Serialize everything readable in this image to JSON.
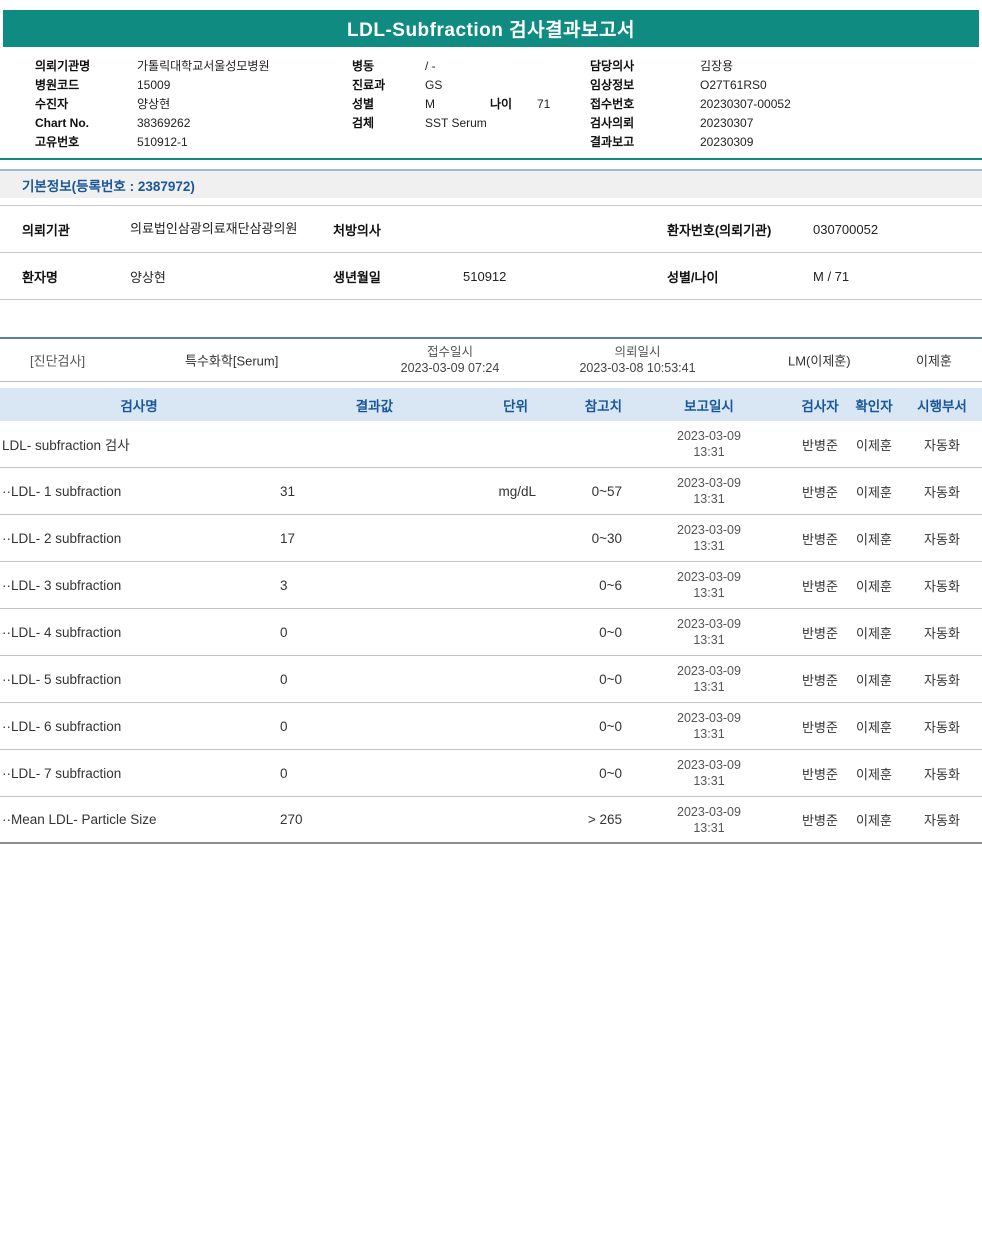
{
  "title": "LDL-Subfraction 검사결과보고서",
  "colors": {
    "teal": "#0F8B81",
    "header_blue": "#1A5799",
    "table_header_bg": "#D9E7F5",
    "section_bar_bg": "#F0F0F0",
    "rule_blue": "#5B7FA8",
    "rule_light_blue": "#9DB8DC"
  },
  "patient_header": {
    "left": [
      {
        "label": "의뢰기관명",
        "value": "가톨릭대학교서울성모병원"
      },
      {
        "label": "병원코드",
        "value": "15009"
      },
      {
        "label": "수진자",
        "value": "양상현"
      },
      {
        "label": "Chart No.",
        "value": "38369262"
      },
      {
        "label": "고유번호",
        "value": "510912-1"
      }
    ],
    "middle": {
      "ward_label": "병동",
      "ward_value": "/ -",
      "dept_label": "진료과",
      "dept_value": "GS",
      "sex_label": "성별",
      "sex_value": "M",
      "age_label": "나이",
      "age_value": "71",
      "specimen_label": "검체",
      "specimen_value": "SST Serum"
    },
    "right": [
      {
        "label": "담당의사",
        "value": "김장용"
      },
      {
        "label": "임상정보",
        "value": "O27T61RS0"
      },
      {
        "label": "접수번호",
        "value": "20230307-00052"
      },
      {
        "label": "검사의뢰",
        "value": "20230307"
      },
      {
        "label": "결과보고",
        "value": "20230309"
      }
    ]
  },
  "basic_info": {
    "section_title": "기본정보(등록번호 : 2387972)",
    "row1": {
      "l1": "의뢰기관",
      "v1": "의료법인삼광의료재단삼광의원",
      "l2": "처방의사",
      "v2": "",
      "l3": "환자번호(의뢰기관)",
      "v3": "030700052"
    },
    "row2": {
      "l1": "환자명",
      "v1": "양상현",
      "l2": "생년월일",
      "v2": "510912",
      "l3": "성별/나이",
      "v3": "M / 71"
    }
  },
  "test_meta": {
    "category": "[진단검사]",
    "panel": "특수화학[Serum]",
    "receive_label": "접수일시",
    "receive_value": "2023-03-09 07:24",
    "order_label": "의뢰일시",
    "order_value": "2023-03-08 10:53:41",
    "lab_code": "LM(이제훈)",
    "reader": "이제훈"
  },
  "results": {
    "headers": {
      "name": "검사명",
      "result": "결과값",
      "unit": "단위",
      "ref": "참고치",
      "report": "보고일시",
      "tester": "검사자",
      "confirmer": "확인자",
      "dept": "시행부서"
    },
    "rows": [
      {
        "name": "LDL- subfraction 검사",
        "result": "",
        "unit": "",
        "ref": "",
        "date": "2023-03-09",
        "time": "13:31",
        "tester": "반병준",
        "confirmer": "이제훈",
        "dept": "자동화"
      },
      {
        "name": "··LDL- 1 subfraction",
        "result": "31",
        "unit": "mg/dL",
        "ref": "0~57",
        "date": "2023-03-09",
        "time": "13:31",
        "tester": "반병준",
        "confirmer": "이제훈",
        "dept": "자동화"
      },
      {
        "name": "··LDL- 2 subfraction",
        "result": "17",
        "unit": "",
        "ref": "0~30",
        "date": "2023-03-09",
        "time": "13:31",
        "tester": "반병준",
        "confirmer": "이제훈",
        "dept": "자동화"
      },
      {
        "name": "··LDL- 3 subfraction",
        "result": "3",
        "unit": "",
        "ref": "0~6",
        "date": "2023-03-09",
        "time": "13:31",
        "tester": "반병준",
        "confirmer": "이제훈",
        "dept": "자동화"
      },
      {
        "name": "··LDL- 4 subfraction",
        "result": "0",
        "unit": "",
        "ref": "0~0",
        "date": "2023-03-09",
        "time": "13:31",
        "tester": "반병준",
        "confirmer": "이제훈",
        "dept": "자동화"
      },
      {
        "name": "··LDL- 5 subfraction",
        "result": "0",
        "unit": "",
        "ref": "0~0",
        "date": "2023-03-09",
        "time": "13:31",
        "tester": "반병준",
        "confirmer": "이제훈",
        "dept": "자동화"
      },
      {
        "name": "··LDL- 6 subfraction",
        "result": "0",
        "unit": "",
        "ref": "0~0",
        "date": "2023-03-09",
        "time": "13:31",
        "tester": "반병준",
        "confirmer": "이제훈",
        "dept": "자동화"
      },
      {
        "name": "··LDL- 7 subfraction",
        "result": "0",
        "unit": "",
        "ref": "0~0",
        "date": "2023-03-09",
        "time": "13:31",
        "tester": "반병준",
        "confirmer": "이제훈",
        "dept": "자동화"
      },
      {
        "name": "··Mean LDL- Particle Size",
        "result": "270",
        "unit": "",
        "ref": "> 265",
        "date": "2023-03-09",
        "time": "13:31",
        "tester": "반병준",
        "confirmer": "이제훈",
        "dept": "자동화"
      }
    ]
  }
}
